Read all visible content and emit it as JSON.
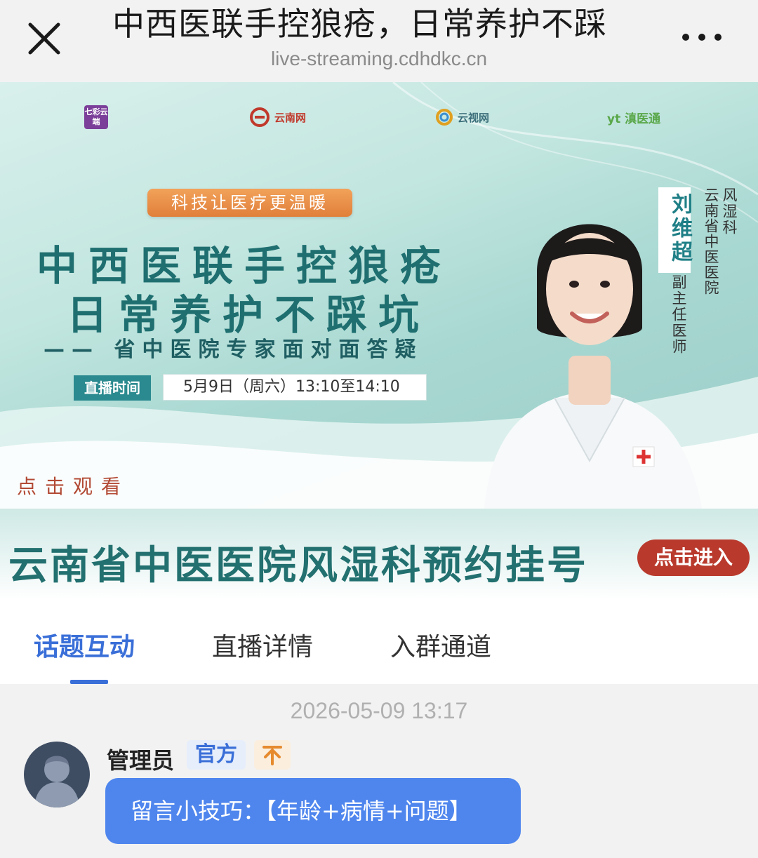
{
  "topbar": {
    "title": "中西医联手控狼疮，日常养护不踩",
    "url": "live-streaming.cdhdkc.cn"
  },
  "banner": {
    "logos": [
      "七彩云端",
      "云南网",
      "云视网",
      "yt 滇医通"
    ],
    "slogan": "科技让医疗更温暖",
    "headline_line1": "中西医联手控狼疮",
    "headline_line2": "日常养护不踩坑",
    "subline": "—— 省中医院专家面对面答疑",
    "live_label": "直播时间",
    "live_time": "5月9日（周六）13:10至14:10",
    "doctor_name": "刘维超",
    "doctor_title": "副主任医师",
    "doctor_dept": "风湿科",
    "doctor_hospital": "云南省中医医院",
    "watch_label": "点击观看"
  },
  "appointment": {
    "text": "云南省中医医院风湿科预约挂号",
    "button": "点击进入"
  },
  "tabs": [
    {
      "label": "话题互动",
      "active": true
    },
    {
      "label": "直播详情",
      "active": false
    },
    {
      "label": "入群通道",
      "active": false
    }
  ],
  "chat": {
    "timestamp": "2026-05-09 13:17",
    "sender": "管理员",
    "badge": "官方",
    "message": "留言小技巧：【年龄+病情+问题】"
  },
  "colors": {
    "accent_blue": "#3a6fd8",
    "bubble_blue": "#4f86ee",
    "teal": "#1f6f70",
    "button_red": "#b93a2d"
  }
}
